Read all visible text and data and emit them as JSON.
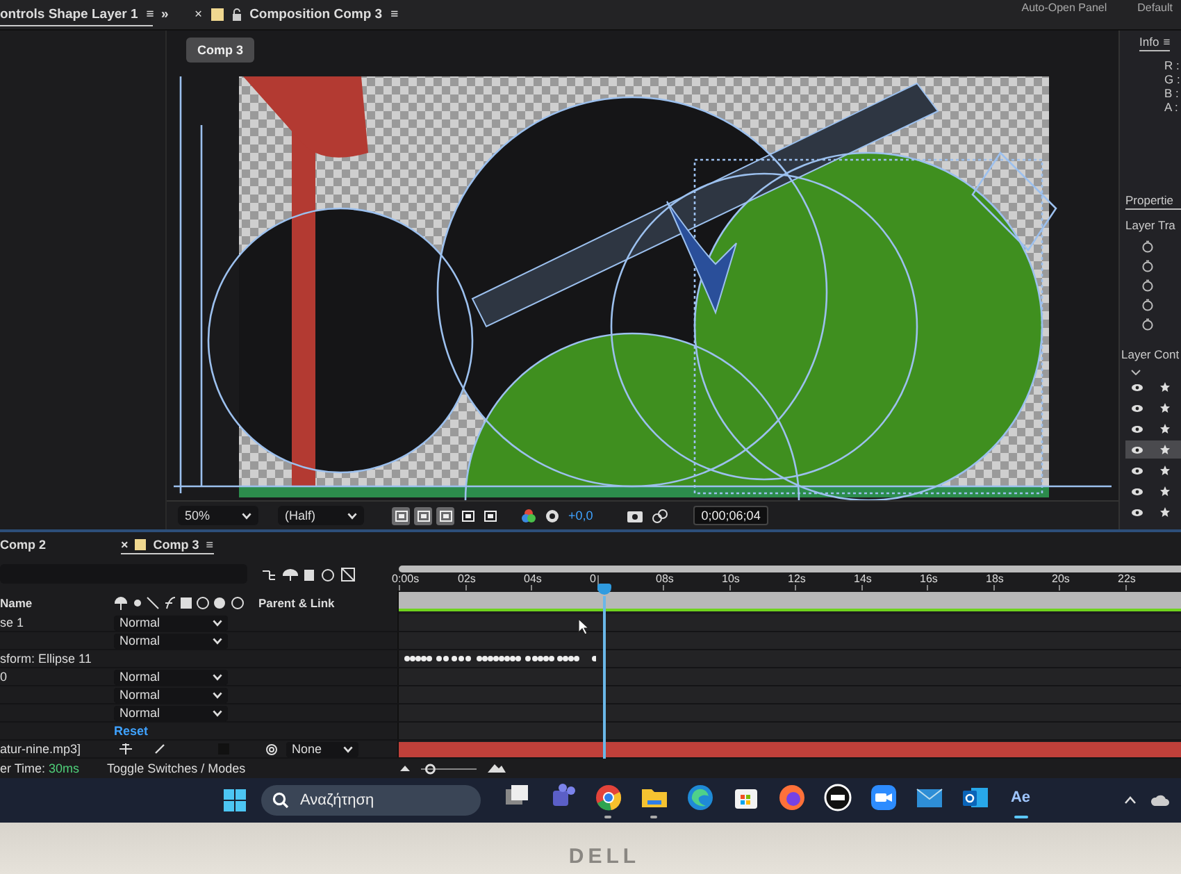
{
  "top_bar": {
    "left_panel_tab": {
      "title": "ontrols Shape Layer 1",
      "menu": "≡"
    },
    "expand": "»",
    "composition_tab": {
      "close": "×",
      "title": "Composition Comp 3",
      "menu": "≡"
    },
    "auto_open": "Auto-Open Panel",
    "workspace": "Default"
  },
  "viewer": {
    "comp_button": "Comp 3",
    "toolbar": {
      "zoom": "50%",
      "resolution": "(Half)",
      "view_toggles": [
        {
          "selected": true
        },
        {
          "selected": true
        },
        {
          "selected": true
        },
        {
          "selected": false
        },
        {
          "selected": false
        }
      ],
      "exposure": "+0,0",
      "timecode": "0;00;06;04"
    }
  },
  "info": {
    "title": "Info",
    "menu": "≡",
    "channels": [
      "R :",
      "G :",
      "B :",
      "A :"
    ]
  },
  "properties": {
    "title": "Propertie",
    "transform_title": "Layer Tra",
    "contents_title": "Layer Cont",
    "contents_items": [
      {
        "selected": false
      },
      {
        "selected": false
      },
      {
        "selected": false
      },
      {
        "selected": true
      },
      {
        "selected": false
      },
      {
        "selected": false
      },
      {
        "selected": false
      }
    ]
  },
  "timeline": {
    "tabs": [
      {
        "label": "Comp 2",
        "selected": false
      },
      {
        "label": "Comp 3",
        "selected": true
      }
    ],
    "close": "×",
    "menu": "≡",
    "columns": {
      "name": "Name",
      "parent": "Parent & Link"
    },
    "ruler": [
      "0:00s",
      "02s",
      "04s",
      "0",
      "08s",
      "10s",
      "12s",
      "14s",
      "16s",
      "18s",
      "20s",
      "22s"
    ],
    "layers": [
      {
        "kind": "layer",
        "name": "se 1",
        "mode": "Normal"
      },
      {
        "kind": "layer",
        "mode": "Normal"
      },
      {
        "kind": "group",
        "name": "sform: Ellipse 11"
      },
      {
        "kind": "layer",
        "name": "0",
        "mode": "Normal"
      },
      {
        "kind": "layer",
        "mode": "Normal"
      },
      {
        "kind": "layer",
        "mode": "Normal"
      },
      {
        "kind": "reset",
        "name": "Reset"
      },
      {
        "kind": "audio",
        "name": "atur-nine.mp3]",
        "parent": "None",
        "switch_checked": false
      }
    ],
    "footer": {
      "label": "er Time:",
      "value": "30ms",
      "toggle": "Toggle Switches / Modes",
      "zoom": {
        "level": 0.15
      }
    }
  },
  "taskbar": {
    "search": "Αναζήτηση",
    "apps": [
      {
        "kind": "taskview",
        "running": false
      },
      {
        "kind": "teams",
        "running": false
      },
      {
        "kind": "chrome",
        "running": true
      },
      {
        "kind": "folder",
        "running": true
      },
      {
        "kind": "edge",
        "running": false
      },
      {
        "kind": "store",
        "running": false
      },
      {
        "kind": "firefox",
        "running": false
      },
      {
        "kind": "dell",
        "running": false
      },
      {
        "kind": "zoom",
        "running": false
      },
      {
        "kind": "mail",
        "running": false
      },
      {
        "kind": "outlook",
        "running": false
      },
      {
        "kind": "ae",
        "label": "Ae",
        "running": true
      }
    ]
  },
  "bezel": {
    "brand": "DELL"
  }
}
